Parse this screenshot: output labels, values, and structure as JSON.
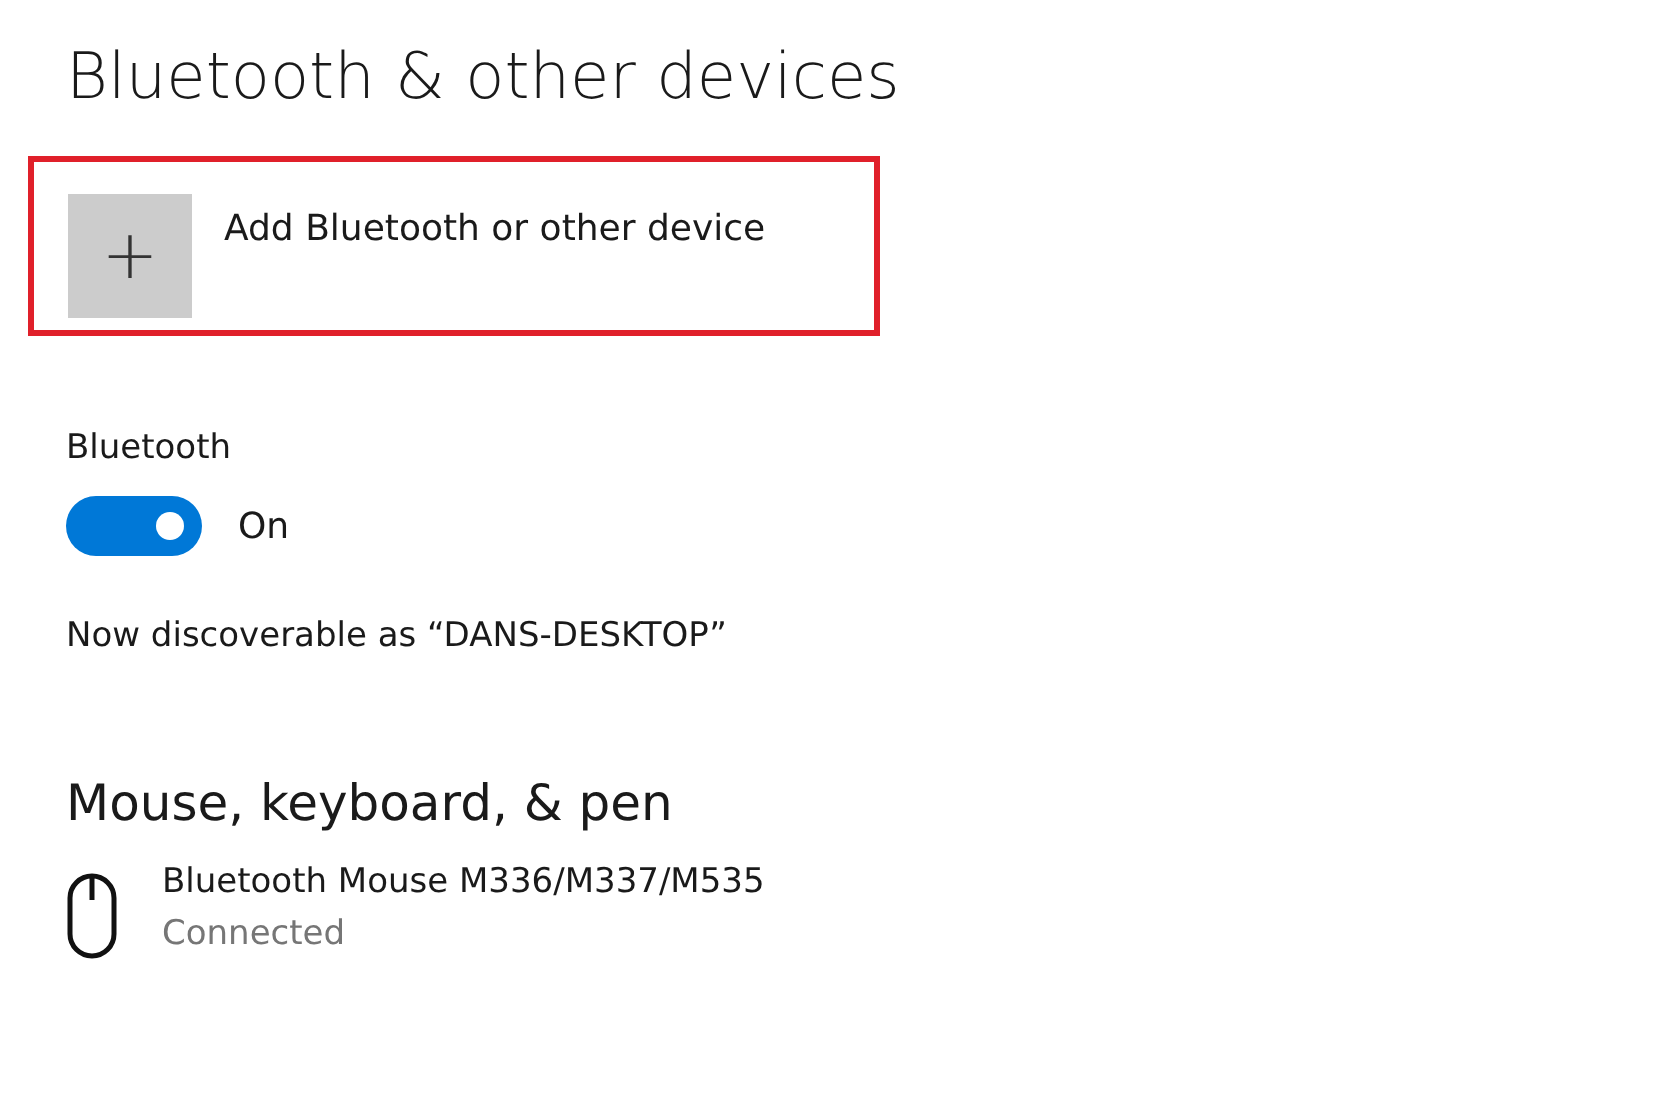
{
  "title": "Bluetooth & other devices",
  "add_device": {
    "label": "Add Bluetooth or other device",
    "icon": "+",
    "highlighted": true
  },
  "bluetooth": {
    "label": "Bluetooth",
    "on": true,
    "state_label": "On"
  },
  "discoverable": "Now discoverable as “DANS-DESKTOP”",
  "sections": [
    {
      "title": "Mouse, keyboard, & pen",
      "devices": [
        {
          "kind": "mouse",
          "name": "Bluetooth Mouse M336/M337/M535",
          "status": "Connected"
        }
      ]
    }
  ]
}
